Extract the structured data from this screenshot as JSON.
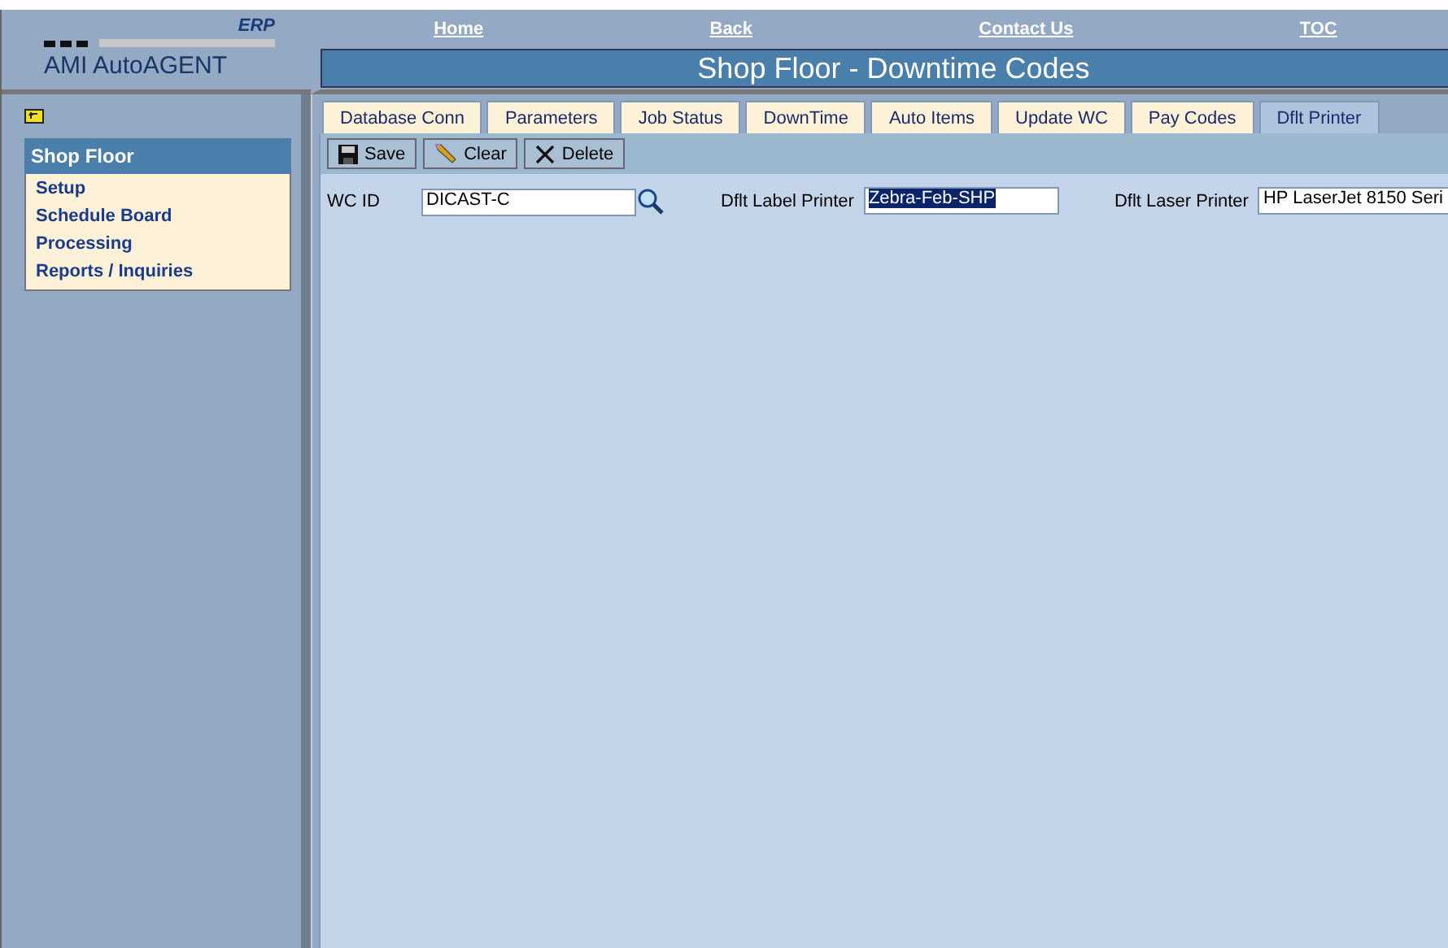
{
  "header": {
    "tagline": "ERP",
    "product": "AMI AutoAGENT",
    "nav": [
      "Home",
      "Back",
      "Contact Us",
      "TOC"
    ],
    "title": "Shop Floor - Downtime Codes"
  },
  "sidebar": {
    "section": "Shop Floor",
    "items": [
      "Setup",
      "Schedule Board",
      "Processing",
      "Reports / Inquiries"
    ]
  },
  "tabs": [
    {
      "label": "Database Conn",
      "selected": false
    },
    {
      "label": "Parameters",
      "selected": false
    },
    {
      "label": "Job Status",
      "selected": false
    },
    {
      "label": "DownTime",
      "selected": false
    },
    {
      "label": "Auto Items",
      "selected": false
    },
    {
      "label": "Update WC",
      "selected": false
    },
    {
      "label": "Pay Codes",
      "selected": false
    },
    {
      "label": "Dflt Printer",
      "selected": true
    }
  ],
  "toolbar": [
    {
      "kind": "save",
      "label": "Save"
    },
    {
      "kind": "clear",
      "label": "Clear"
    },
    {
      "kind": "delete",
      "label": "Delete"
    }
  ],
  "fields": [
    {
      "label": "WC ID",
      "value": "DICAST-C",
      "lookup": true,
      "highlighted": false
    },
    {
      "label": "Dflt Label Printer",
      "value": "Zebra-Feb-SHP",
      "lookup": false,
      "highlighted": true
    },
    {
      "label": "Dflt Laser Printer",
      "value": "HP LaserJet 8150 Seri",
      "lookup": false,
      "highlighted": false
    }
  ]
}
